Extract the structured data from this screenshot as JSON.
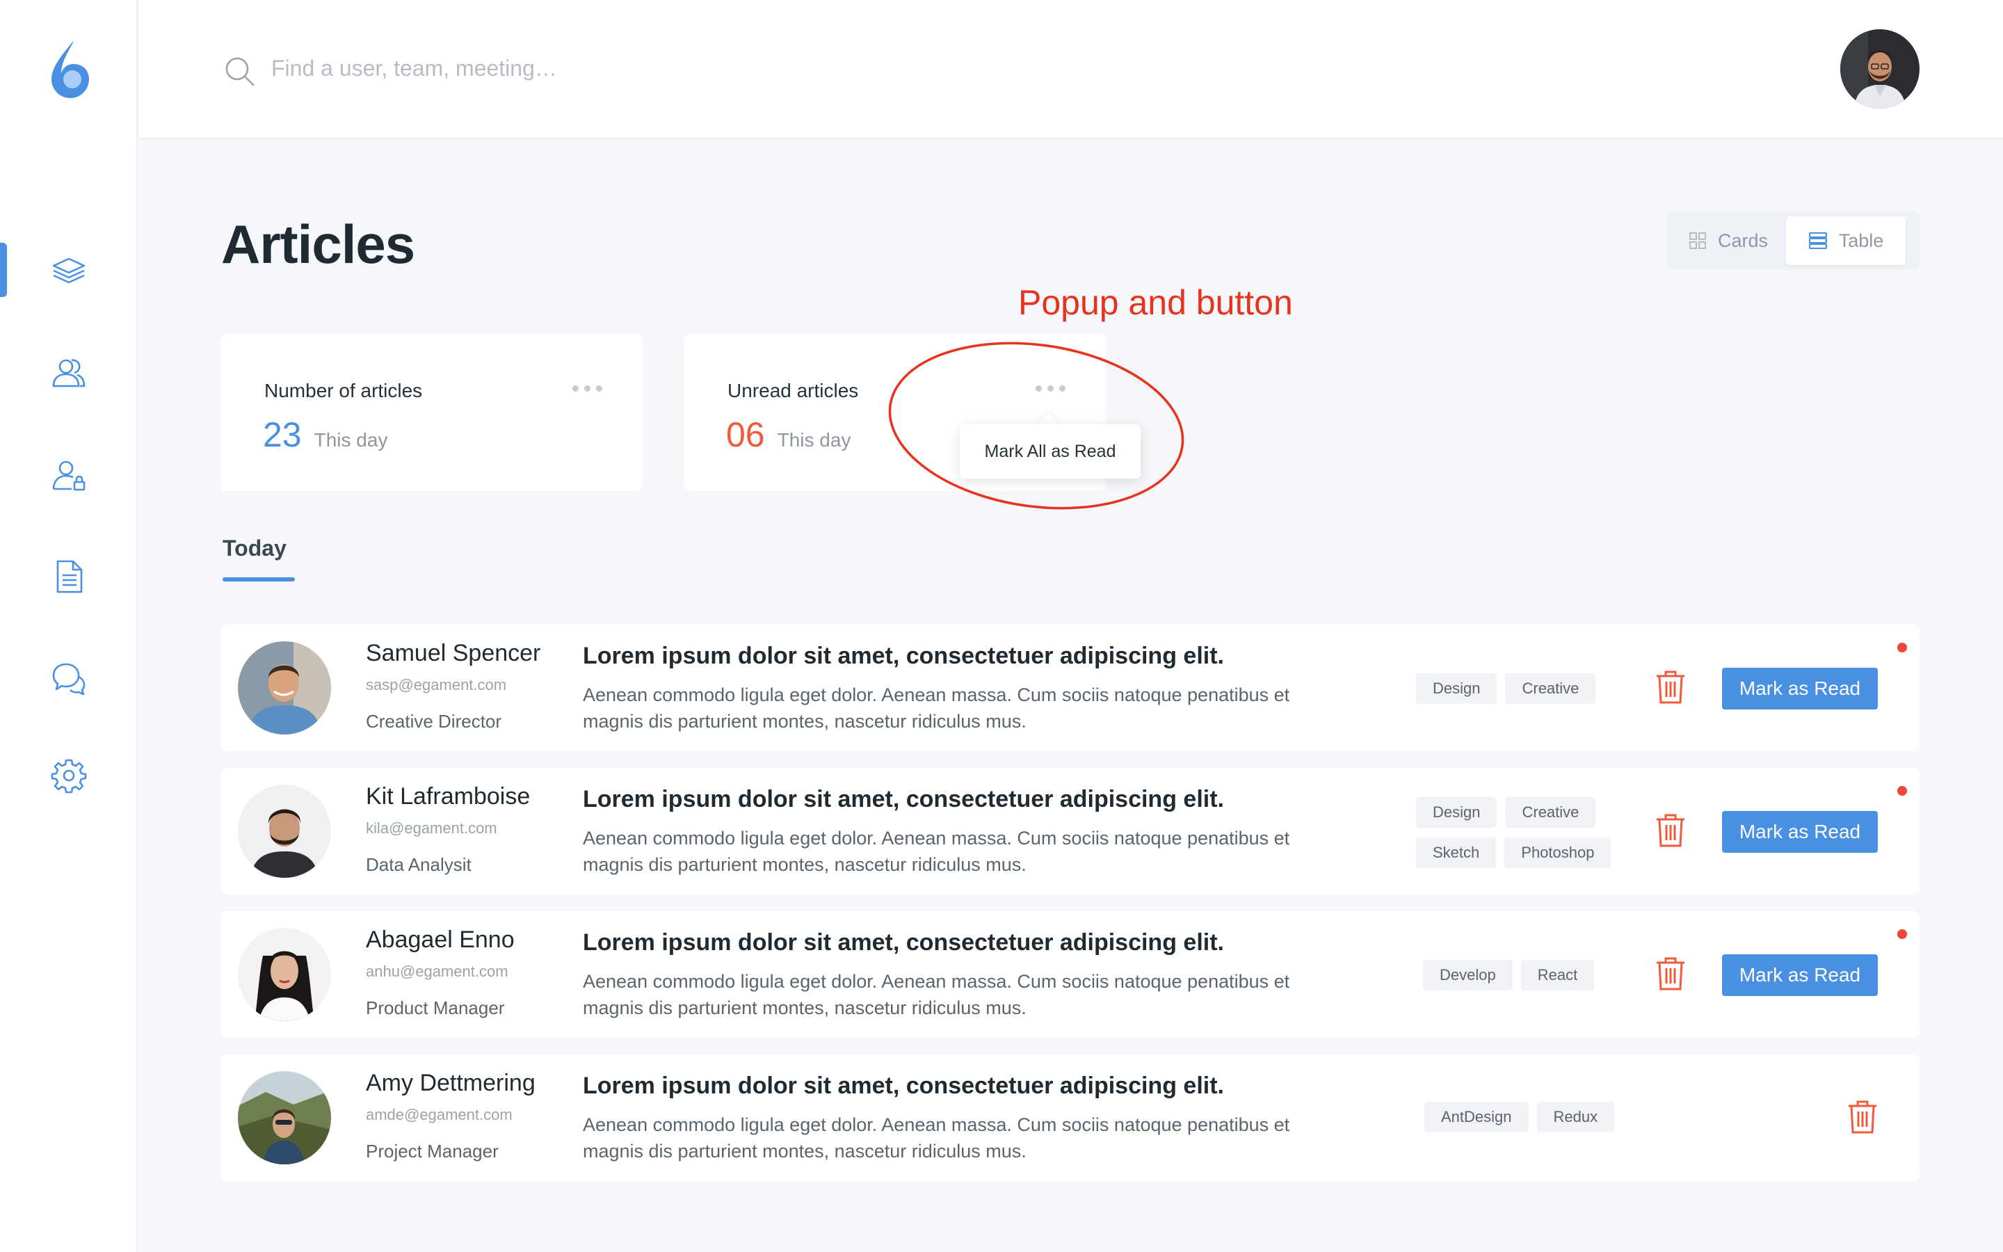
{
  "header": {
    "search_placeholder": "Find a user, team, meeting…"
  },
  "sidebar": {
    "items": [
      {
        "icon": "layers-icon",
        "active": true
      },
      {
        "icon": "users-icon",
        "active": false
      },
      {
        "icon": "user-lock-icon",
        "active": false
      },
      {
        "icon": "document-icon",
        "active": false
      },
      {
        "icon": "chat-icon",
        "active": false
      },
      {
        "icon": "gear-icon",
        "active": false
      }
    ]
  },
  "page": {
    "title": "Articles",
    "view_cards": "Cards",
    "view_table": "Table",
    "annotation": "Popup and button"
  },
  "stats": {
    "card1": {
      "title": "Number of articles",
      "value": "23",
      "sub": "This day"
    },
    "card2": {
      "title": "Unread articles",
      "value": "06",
      "sub": "This day"
    },
    "popup_label": "Mark All as Read"
  },
  "tabs": {
    "today": "Today"
  },
  "rows": [
    {
      "name": "Samuel Spencer",
      "email": "sasp@egament.com",
      "role": "Creative Director",
      "headline": "Lorem ipsum dolor sit amet, consectetuer adipiscing elit.",
      "body": "Aenean commodo ligula eget dolor. Aenean massa. Cum sociis natoque penatibus et magnis dis parturient montes, nascetur ridiculus mus.",
      "tags": [
        "Design",
        "Creative"
      ],
      "action": "Mark as Read",
      "unread": true
    },
    {
      "name": "Kit Laframboise",
      "email": "kila@egament.com",
      "role": "Data Analysit",
      "headline": "Lorem ipsum dolor sit amet, consectetuer adipiscing elit.",
      "body": "Aenean commodo ligula eget dolor. Aenean massa. Cum sociis natoque penatibus et magnis dis parturient montes, nascetur ridiculus mus.",
      "tags": [
        "Design",
        "Creative",
        "Sketch",
        "Photoshop"
      ],
      "action": "Mark as Read",
      "unread": true
    },
    {
      "name": "Abagael Enno",
      "email": "anhu@egament.com",
      "role": "Product Manager",
      "headline": "Lorem ipsum dolor sit amet, consectetuer adipiscing elit.",
      "body": "Aenean commodo ligula eget dolor. Aenean massa. Cum sociis natoque penatibus et magnis dis parturient montes, nascetur ridiculus mus.",
      "tags": [
        "Develop",
        "React"
      ],
      "action": "Mark as Read",
      "unread": true
    },
    {
      "name": "Amy Dettmering",
      "email": "amde@egament.com",
      "role": "Project Manager",
      "headline": "Lorem ipsum dolor sit amet, consectetuer adipiscing elit.",
      "body": "Aenean commodo ligula eget dolor. Aenean massa. Cum sociis natoque penatibus et magnis dis parturient montes, nascetur ridiculus mus.",
      "tags": [
        "AntDesign",
        "Redux"
      ],
      "unread": false
    }
  ],
  "colors": {
    "accent": "#4a90e2",
    "danger": "#f05a3c",
    "annotation": "#e8321e",
    "background": "#f5f7fa"
  }
}
